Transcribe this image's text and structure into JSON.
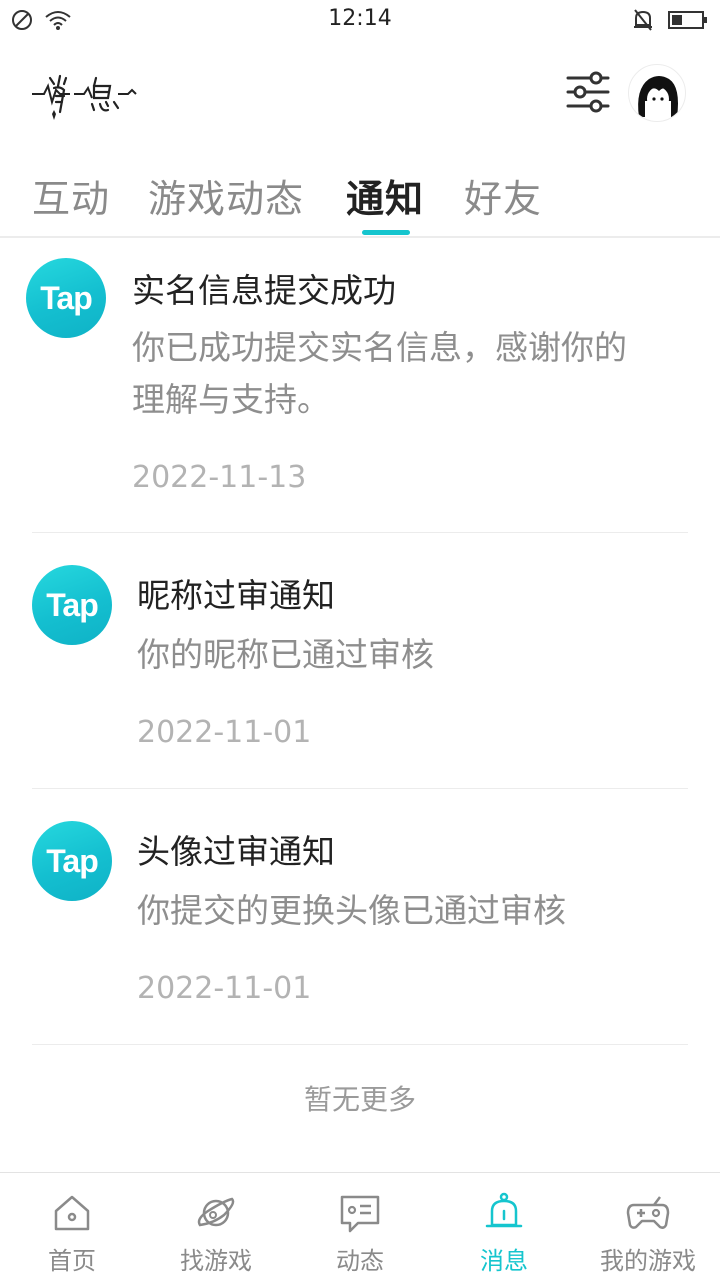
{
  "status_bar": {
    "time": "12:14"
  },
  "header": {
    "logo_text": "消息"
  },
  "tabs": [
    {
      "label": "互动"
    },
    {
      "label": "游戏动态"
    },
    {
      "label": "通知",
      "active": true
    },
    {
      "label": "好友"
    }
  ],
  "notifications": [
    {
      "sender_logo": "Tap",
      "title": "实名信息提交成功",
      "body_line1": "你已成功提交实名信息，感谢你的",
      "body_line2": "理解与支持。",
      "date": "2022-11-13"
    },
    {
      "sender_logo": "Tap",
      "title": "昵称过审通知",
      "body_line1": "你的昵称已通过审核",
      "body_line2": "",
      "date": "2022-11-01"
    },
    {
      "sender_logo": "Tap",
      "title": "头像过审通知",
      "body_line1": "你提交的更换头像已通过审核",
      "body_line2": "",
      "date": "2022-11-01"
    }
  ],
  "footer_text": "暂无更多",
  "bottom_nav": [
    {
      "label": "首页",
      "icon": "home-icon"
    },
    {
      "label": "找游戏",
      "icon": "planet-icon"
    },
    {
      "label": "动态",
      "icon": "chat-icon"
    },
    {
      "label": "消息",
      "icon": "bell-icon",
      "active": true
    },
    {
      "label": "我的游戏",
      "icon": "gamepad-icon"
    }
  ],
  "colors": {
    "accent": "#15c5ce",
    "tap_logo": "#14bfd0",
    "muted_text": "#8e8e8e",
    "date_text": "#b3b3b3"
  }
}
